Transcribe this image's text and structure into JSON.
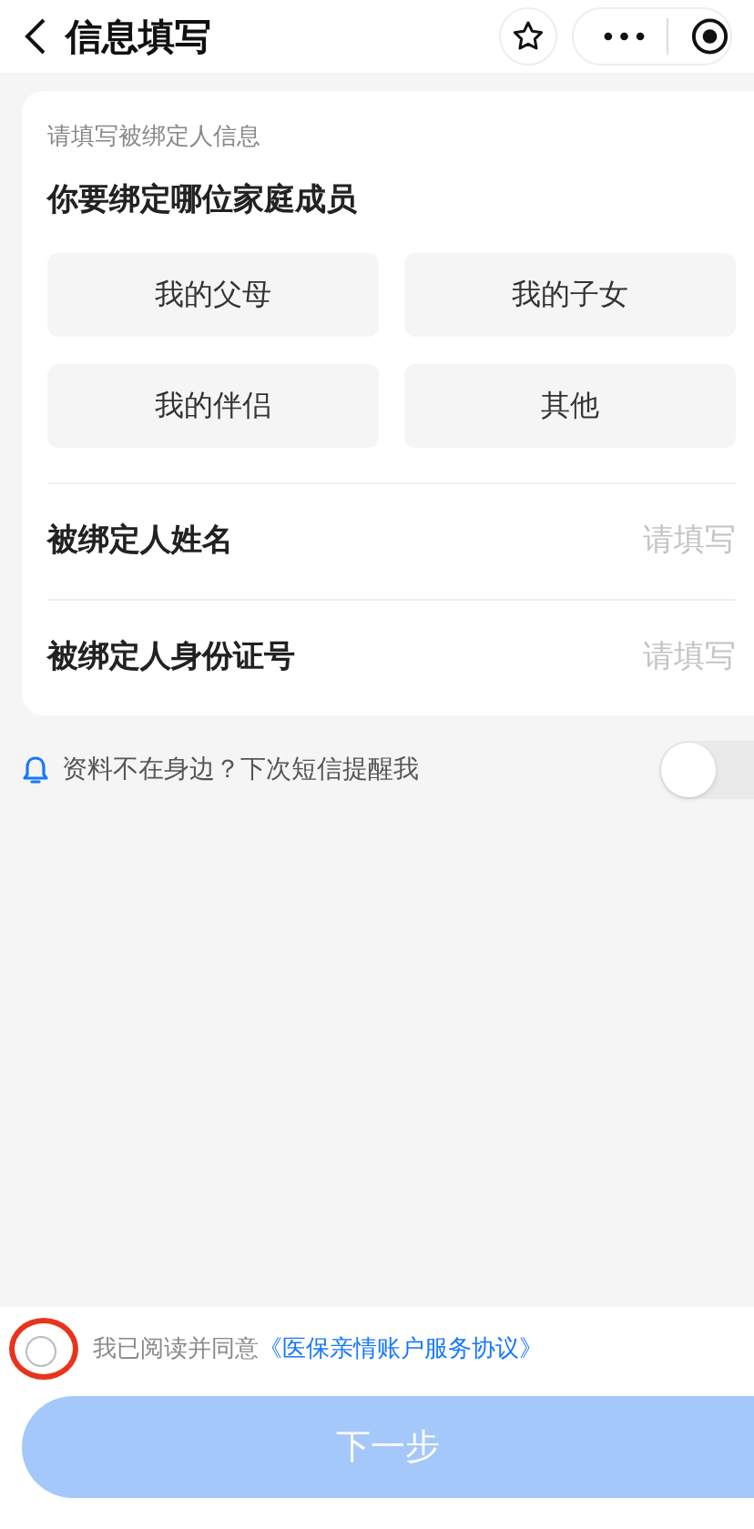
{
  "header": {
    "title": "信息填写"
  },
  "card": {
    "hint": "请填写被绑定人信息",
    "question": "你要绑定哪位家庭成员",
    "options": [
      {
        "label": "我的父母",
        "selected": false
      },
      {
        "label": "我的子女",
        "selected": false
      },
      {
        "label": "我的伴侣",
        "selected": false
      },
      {
        "label": "其他",
        "selected": false
      }
    ],
    "fields": [
      {
        "label": "被绑定人姓名",
        "placeholder": "请填写"
      },
      {
        "label": "被绑定人身份证号",
        "placeholder": "请填写"
      }
    ]
  },
  "reminder": {
    "text": "资料不在身边？下次短信提醒我",
    "on": false
  },
  "agreement": {
    "text": "我已阅读并同意",
    "link": "《医保亲情账户服务协议》",
    "checked": false,
    "highlighted": true
  },
  "next_button": {
    "label": "下一步",
    "disabled": true
  }
}
